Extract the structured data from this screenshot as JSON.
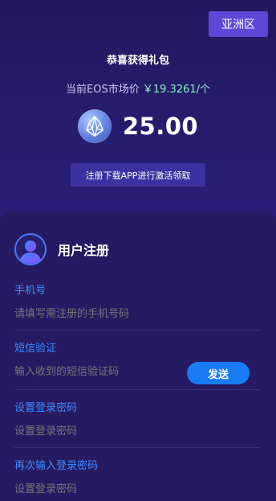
{
  "header": {
    "region_label": "亚洲区",
    "gift_title": "恭喜获得礼包",
    "price_prefix": "当前EOS市场价",
    "price_value": "￥19.3261/个",
    "amount": "25.00",
    "register_download_label": "注册下载APP进行激活领取"
  },
  "form": {
    "title": "用户注册",
    "phone": {
      "label": "手机号",
      "placeholder": "请填写需注册的手机号码"
    },
    "sms": {
      "label": "短信验证",
      "placeholder": "输入收到的短信验证码",
      "send_label": "发送"
    },
    "password": {
      "label": "设置登录密码",
      "placeholder": "设置登录密码"
    },
    "password_confirm": {
      "label": "再次输入登录密码",
      "placeholder": "设置登录密码"
    }
  },
  "icons": {
    "eos": "eos-logo-icon",
    "avatar": "user-avatar-icon"
  },
  "colors": {
    "accent_blue": "#1a7cf5",
    "label_blue": "#3e8bff",
    "region_purple": "#5e46d8",
    "price_green": "#8ff0c6"
  }
}
